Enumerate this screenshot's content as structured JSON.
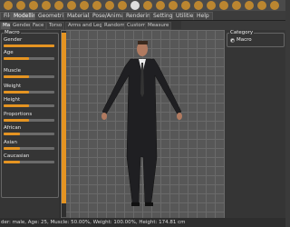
{
  "tabs": [
    {
      "label": "Files"
    },
    {
      "label": "Modelling"
    },
    {
      "label": "Geometries"
    },
    {
      "label": "Materials"
    },
    {
      "label": "Pose/Animate"
    },
    {
      "label": "Rendering"
    },
    {
      "label": "Settings"
    },
    {
      "label": "Utilities"
    },
    {
      "label": "Help"
    }
  ],
  "subtabs": [
    {
      "label": "Main"
    },
    {
      "label": "Gender"
    },
    {
      "label": "Face"
    },
    {
      "label": "Torso"
    },
    {
      "label": "Arms and Legs"
    },
    {
      "label": "Random"
    },
    {
      "label": "Custom"
    },
    {
      "label": "Measure"
    }
  ],
  "left_panel": {
    "group_title": "Macro",
    "sliders": [
      {
        "label": "Gender",
        "value": 1.0
      },
      {
        "label": "Age",
        "value": 0.5
      },
      {
        "label": "Muscle",
        "value": 0.5
      },
      {
        "label": "Weight",
        "value": 0.5
      },
      {
        "label": "Height",
        "value": 0.5
      },
      {
        "label": "Proportions",
        "value": 0.5
      },
      {
        "label": "African",
        "value": 0.33
      },
      {
        "label": "Asian",
        "value": 0.33
      },
      {
        "label": "Caucasian",
        "value": 0.33
      }
    ]
  },
  "right_panel": {
    "category_title": "Category",
    "option": "Macro"
  },
  "status_bar": "der: male, Age: 25, Muscle: 50.00%, Weight: 100.00%, Height: 174.81 cm",
  "colors": {
    "accent": "#e59422",
    "viewport": "#575757"
  }
}
